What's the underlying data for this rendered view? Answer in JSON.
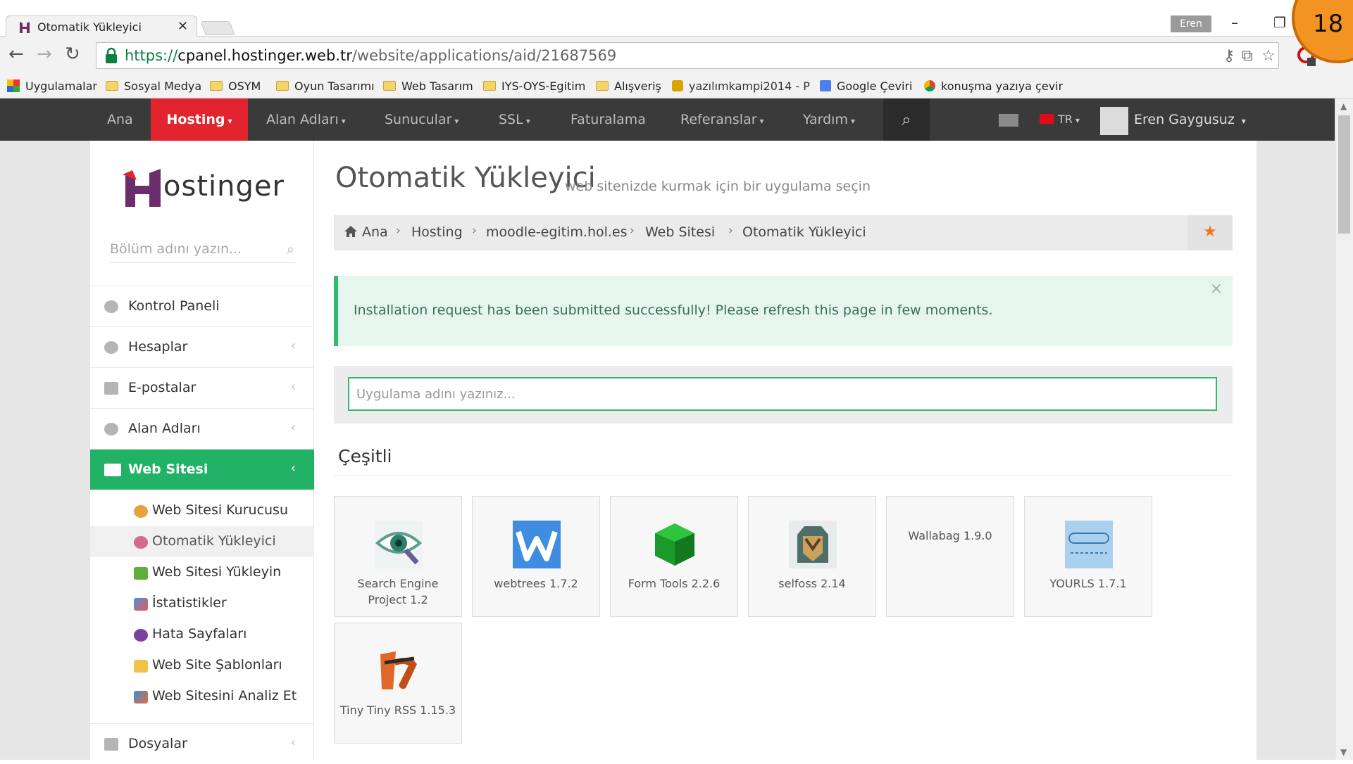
{
  "browser": {
    "tab_title": "Otomatik Yükleyici",
    "tab_close": "✕",
    "profile_name": "Eren",
    "url_scheme": "https://",
    "url_host": "cpanel.hostinger.web.tr",
    "url_path": "/website/applications/aid/21687569",
    "bookmarks": [
      "Uygulamalar",
      "Sosyal Medya",
      "OSYM",
      "Oyun Tasarımı",
      "Web Tasarım",
      "IYS-OYS-Egitim",
      "Alışveriş",
      "yazılımkampi2014 - P",
      "Google Çeviri",
      "konuşma yazıya çevir"
    ]
  },
  "slide_number": "18",
  "nav": {
    "items": [
      "Ana",
      "Hosting",
      "Alan Adları",
      "Sunucular",
      "SSL",
      "Faturalama",
      "Referanslar",
      "Yardım"
    ],
    "lang": "TR",
    "user": "Eren Gaygusuz"
  },
  "sidebar": {
    "logo_text": "ostinger",
    "search_placeholder": "Bölüm adını yazın...",
    "items": [
      "Kontrol Paneli",
      "Hesaplar",
      "E-postalar",
      "Alan Adları",
      "Web Sitesi"
    ],
    "sub_items": [
      "Web Sitesi Kurucusu",
      "Otomatik Yükleyici",
      "Web Sitesi Yükleyin",
      "İstatistikler",
      "Hata Sayfaları",
      "Web Site Şablonları",
      "Web Sitesini Analiz Et"
    ],
    "bottom_item": "Dosyalar"
  },
  "content": {
    "title": "Otomatik Yükleyici",
    "subtitle": "web sitenizde kurmak için bir uygulama seçin",
    "breadcrumb": [
      "Ana",
      "Hosting",
      "moodle-egitim.hol.es",
      "Web Sitesi",
      "Otomatik Yükleyici"
    ],
    "alert": "Installation request has been submitted successfully! Please refresh this page in few moments.",
    "app_search_placeholder": "Uygulama adını yazınız...",
    "section_title": "Çeşitli",
    "apps": [
      "Search Engine Project 1.2",
      "webtrees 1.7.2",
      "Form Tools 2.2.6",
      "selfoss 2.14",
      "Wallabag 1.9.0",
      "YOURLS 1.7.1",
      "Tiny Tiny RSS 1.15.3"
    ]
  },
  "colors": {
    "accent_red": "#e2242f",
    "accent_green": "#22b266",
    "nav_bg": "#3a3a3a",
    "badge_orange": "#f39322"
  }
}
